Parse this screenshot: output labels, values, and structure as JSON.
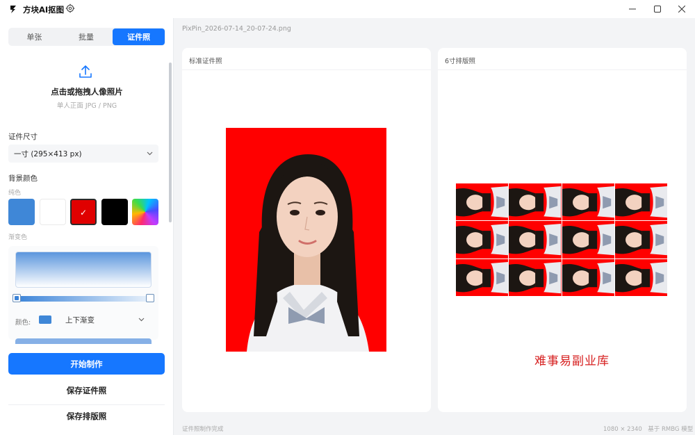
{
  "app": {
    "title": "方块AI抠图"
  },
  "sidebar": {
    "tabs": [
      {
        "label": "单张"
      },
      {
        "label": "批量"
      },
      {
        "label": "证件照"
      }
    ],
    "upload": {
      "title": "点击或拖拽人像照片",
      "subtitle": "单人正面 JPG / PNG"
    },
    "size_label": "证件尺寸",
    "size_value": "一寸 (295×413 px)",
    "bg_label": "背景颜色",
    "solid_label": "纯色",
    "gradient_label": "渐变色",
    "swatch_colors": [
      "#3f87d7",
      "#ffffff",
      "#e00000",
      "#000000"
    ],
    "gradient_color_label": "颜色:",
    "gradient_direction": "上下渐变",
    "start_button": "开始制作",
    "save_photo_button": "保存证件照",
    "save_layout_button": "保存排版照"
  },
  "main": {
    "filename": "PixPin_2026-07-14_20-07-24.png",
    "left_panel_title": "标准证件照",
    "right_panel_title": "6寸排版照",
    "watermark": "难事易副业库",
    "status_left": "证件照制作完成",
    "status_right": "1080 × 2340　基于 RMBG 模型"
  },
  "colors": {
    "accent": "#1677ff",
    "photo_bg": "#ff0000"
  }
}
